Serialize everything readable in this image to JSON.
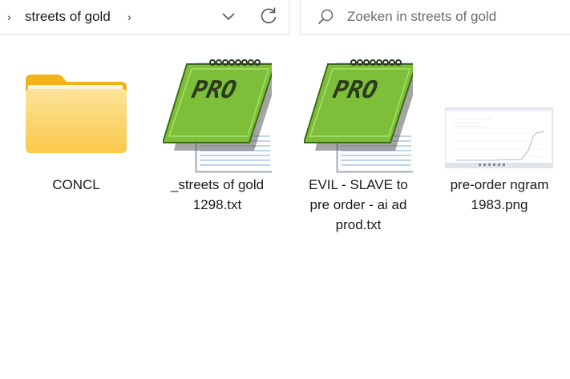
{
  "address_bar": {
    "breadcrumb": "streets of gold",
    "chevron_left": "›",
    "chevron_right": "›"
  },
  "search": {
    "placeholder": "Zoeken in streets of gold"
  },
  "files": [
    {
      "name": "CONCL",
      "icon": "folder-icon"
    },
    {
      "name_lines": [
        "_streets of gold",
        "1298.txt"
      ],
      "icon": "editpad-pro-icon",
      "badge": "PRO"
    },
    {
      "name_lines": [
        "EVIL - SLAVE to",
        "pre order - ai ad",
        "prod.txt"
      ],
      "icon": "editpad-pro-icon",
      "badge": "PRO"
    },
    {
      "name_lines": [
        "pre-order ngram",
        "1983.png"
      ],
      "icon": "image-thumbnail"
    }
  ],
  "colors": {
    "folder_yellow": "#fbc943",
    "notepad_green": "#76b82a",
    "border": "#e3e3e3"
  }
}
